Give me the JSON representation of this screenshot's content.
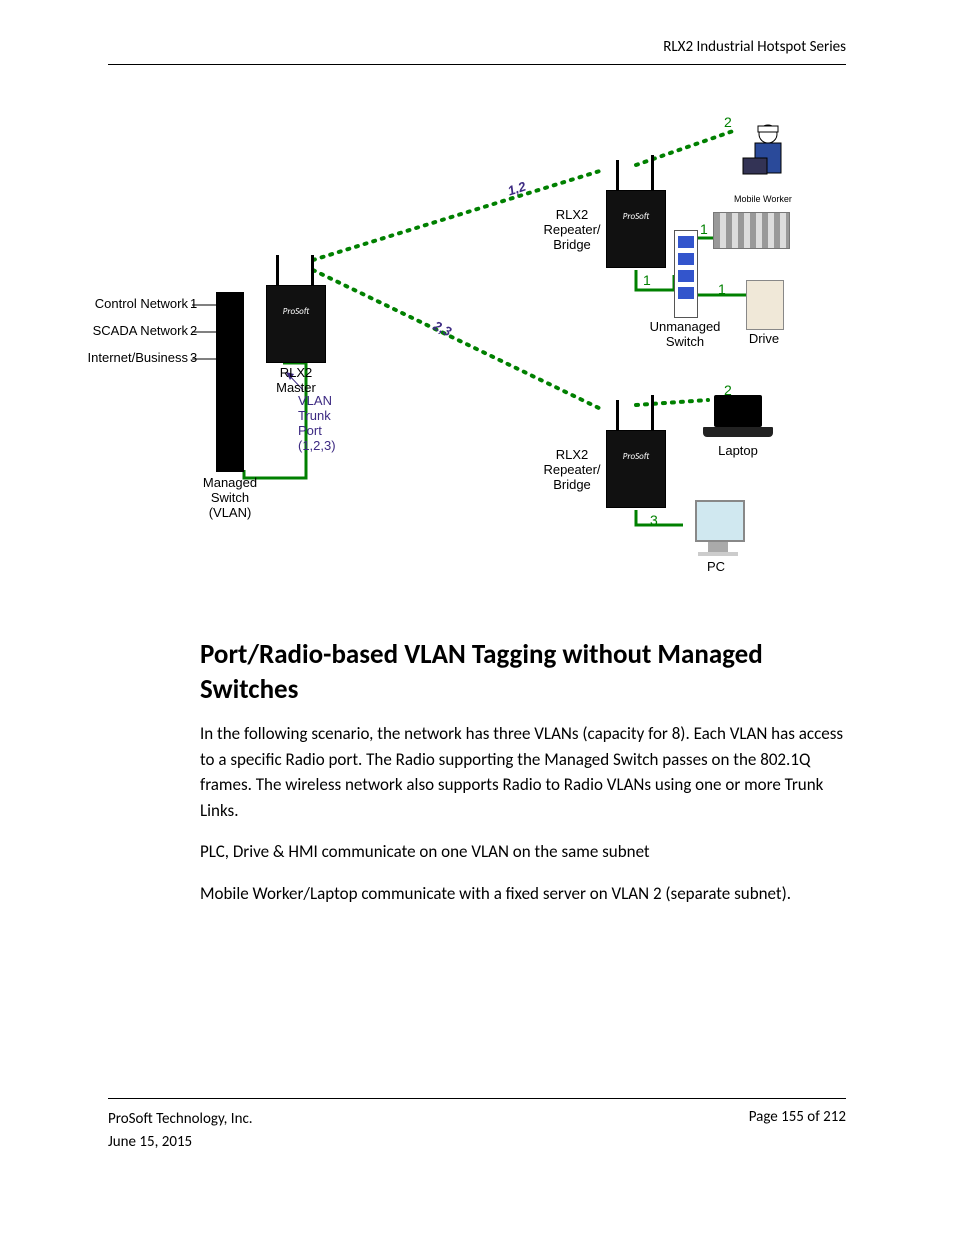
{
  "header": {
    "title": "RLX2 Industrial Hotspot Series"
  },
  "footer": {
    "company": "ProSoft Technology, Inc.",
    "date": "June 15, 2015",
    "page": "Page 155 of 212"
  },
  "content": {
    "heading": "Port/Radio-based VLAN Tagging without Managed Switches",
    "p1": "In the following scenario, the network has three VLANs (capacity for 8).  Each VLAN has access to a specific Radio port.  The Radio supporting the Managed Switch passes on the 802.1Q frames.  The wireless network also supports Radio to Radio VLANs using one or more Trunk Links.",
    "p2": "PLC, Drive & HMI communicate on one VLAN on the same subnet",
    "p3": "Mobile Worker/Laptop communicate with a fixed server on VLAN 2 (separate subnet)."
  },
  "diagram": {
    "left_labels": {
      "l1": "Control Network",
      "l2": "SCADA Network",
      "l3": "Internet/Business"
    },
    "left_nums": {
      "n1": "1",
      "n2": "2",
      "n3": "3"
    },
    "managed_switch": "Managed\nSwitch\n(VLAN)",
    "master": {
      "name": "RLX2\nMaster",
      "brand": "ProSoft"
    },
    "vlan_trunk": "VLAN\nTrunk\nPort\n(1,2,3)",
    "repeater_top": {
      "name": "RLX2\nRepeater/\nBridge",
      "brand": "ProSoft"
    },
    "repeater_bot": {
      "name": "RLX2\nRepeater/\nBridge",
      "brand": "ProSoft"
    },
    "unmanaged": "Unmanaged\nSwitch",
    "worker": "Mobile Worker",
    "drive": "Drive",
    "laptop": "Laptop",
    "pc": "PC",
    "link_top": "1,2",
    "link_bot": "2,3",
    "n1a": "1",
    "n1b": "1",
    "n1c": "1",
    "n2a": "2",
    "n2b": "2",
    "n3a": "3"
  }
}
